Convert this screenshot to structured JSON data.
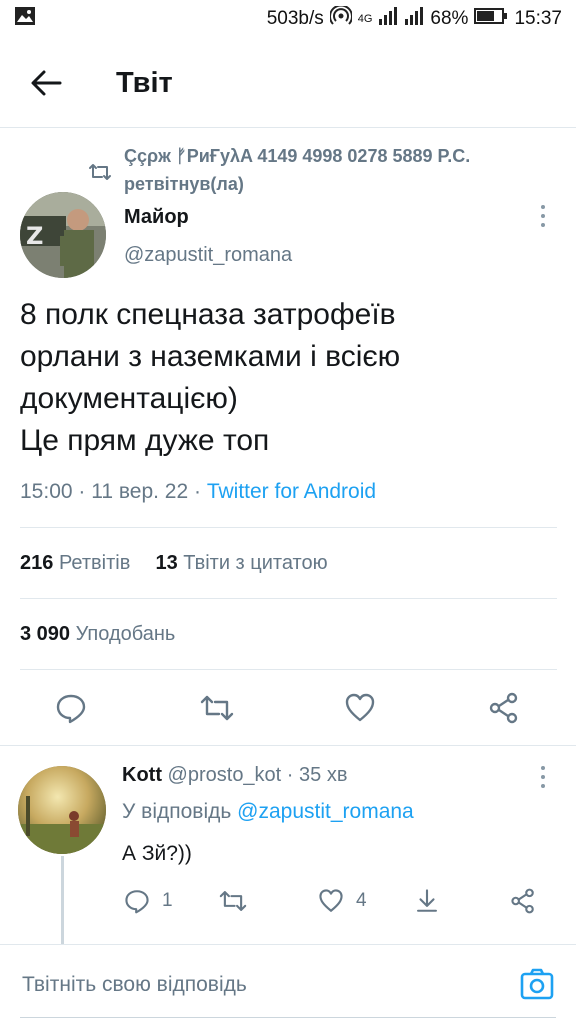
{
  "status_bar": {
    "speed": "503b/s",
    "network": "4G",
    "battery": "68%",
    "time": "15:37"
  },
  "header": {
    "title": "Твіт"
  },
  "retweet": {
    "by": "Ççρж ᚠPиҒуλA 4149 4998 0278 5889 P.C.",
    "label": "ретвітнув(ла)"
  },
  "author": {
    "name": "Майор",
    "handle": "@zapustit_romana"
  },
  "tweet": {
    "lines": [
      "8 полк спецназа затрофеїв",
      "орлани з наземками і всією",
      "документацією)",
      "Це прям дуже топ"
    ],
    "timestamp": "15:00 · 11 вер. 22 · ",
    "source": "Twitter for Android"
  },
  "stats": {
    "retweets_count": "216",
    "retweets_label": "Ретвітів",
    "quotes_count": "13",
    "quotes_label": "Твіти з цитатою",
    "likes_count": "3 090",
    "likes_label": "Уподобань"
  },
  "reply": {
    "name": "Kott",
    "handle": "@prosto_kot",
    "time": " · 35 хв",
    "replying_prefix": "У відповідь ",
    "replying_to": "@zapustit_romana",
    "text": "А Зй?))",
    "reply_count": "1",
    "like_count": "4"
  },
  "compose": {
    "placeholder": "Твітніть свою відповідь"
  },
  "colors": {
    "accent": "#1da1f2",
    "secondary_text": "#657786",
    "divider": "#e1e8ed"
  },
  "icons": [
    "image-icon",
    "hotspot-icon",
    "signal-icon",
    "battery-icon",
    "back-arrow-icon",
    "retweet-icon",
    "more-icon",
    "reply-icon",
    "like-icon",
    "share-icon",
    "bookmark-icon",
    "camera-icon"
  ]
}
